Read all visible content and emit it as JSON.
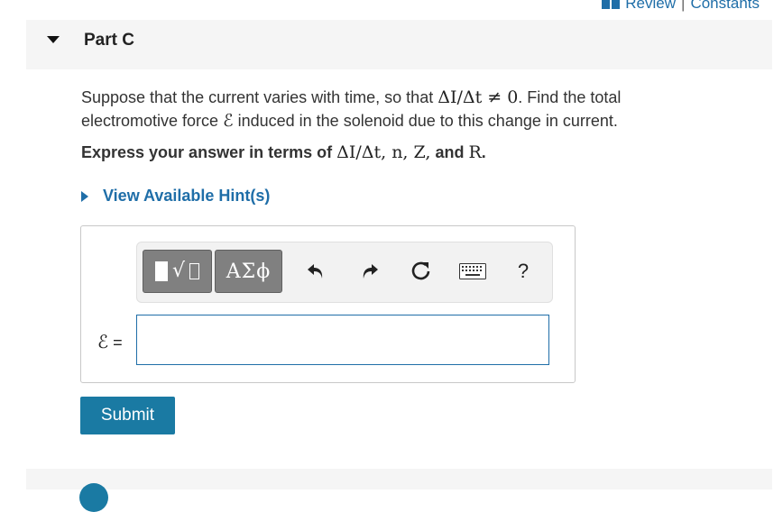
{
  "top_links": {
    "review": "Review",
    "separator": "|",
    "constants": "Constants"
  },
  "part": {
    "title": "Part C"
  },
  "question": {
    "text_before": "Suppose that the current varies with time, so that",
    "math_condition": "ΔI/Δt ≠ 0",
    "text_after": ". Find the total electromotive force",
    "emf_symbol": "ℰ",
    "text_end": "induced in the solenoid due to this change in current."
  },
  "instruction": {
    "prefix": "Express your answer in terms of",
    "terms": "ΔI/Δt, n, Z,",
    "and": "and",
    "last_term": "R",
    "period": "."
  },
  "hint": {
    "label": "View Available Hint(s)"
  },
  "toolbar": {
    "template_icon": "radical-template-icon",
    "greek_label": "ΑΣϕ",
    "undo_icon": "undo-icon",
    "redo_icon": "redo-icon",
    "reset_icon": "reset-icon",
    "keyboard_icon": "keyboard-icon",
    "help_label": "?"
  },
  "answer": {
    "lhs": "ℰ",
    "equals": "=",
    "value": ""
  },
  "submit": {
    "label": "Submit"
  },
  "colors": {
    "link": "#1f6ea8",
    "button": "#1a7aa3",
    "tool_button": "#808080"
  }
}
